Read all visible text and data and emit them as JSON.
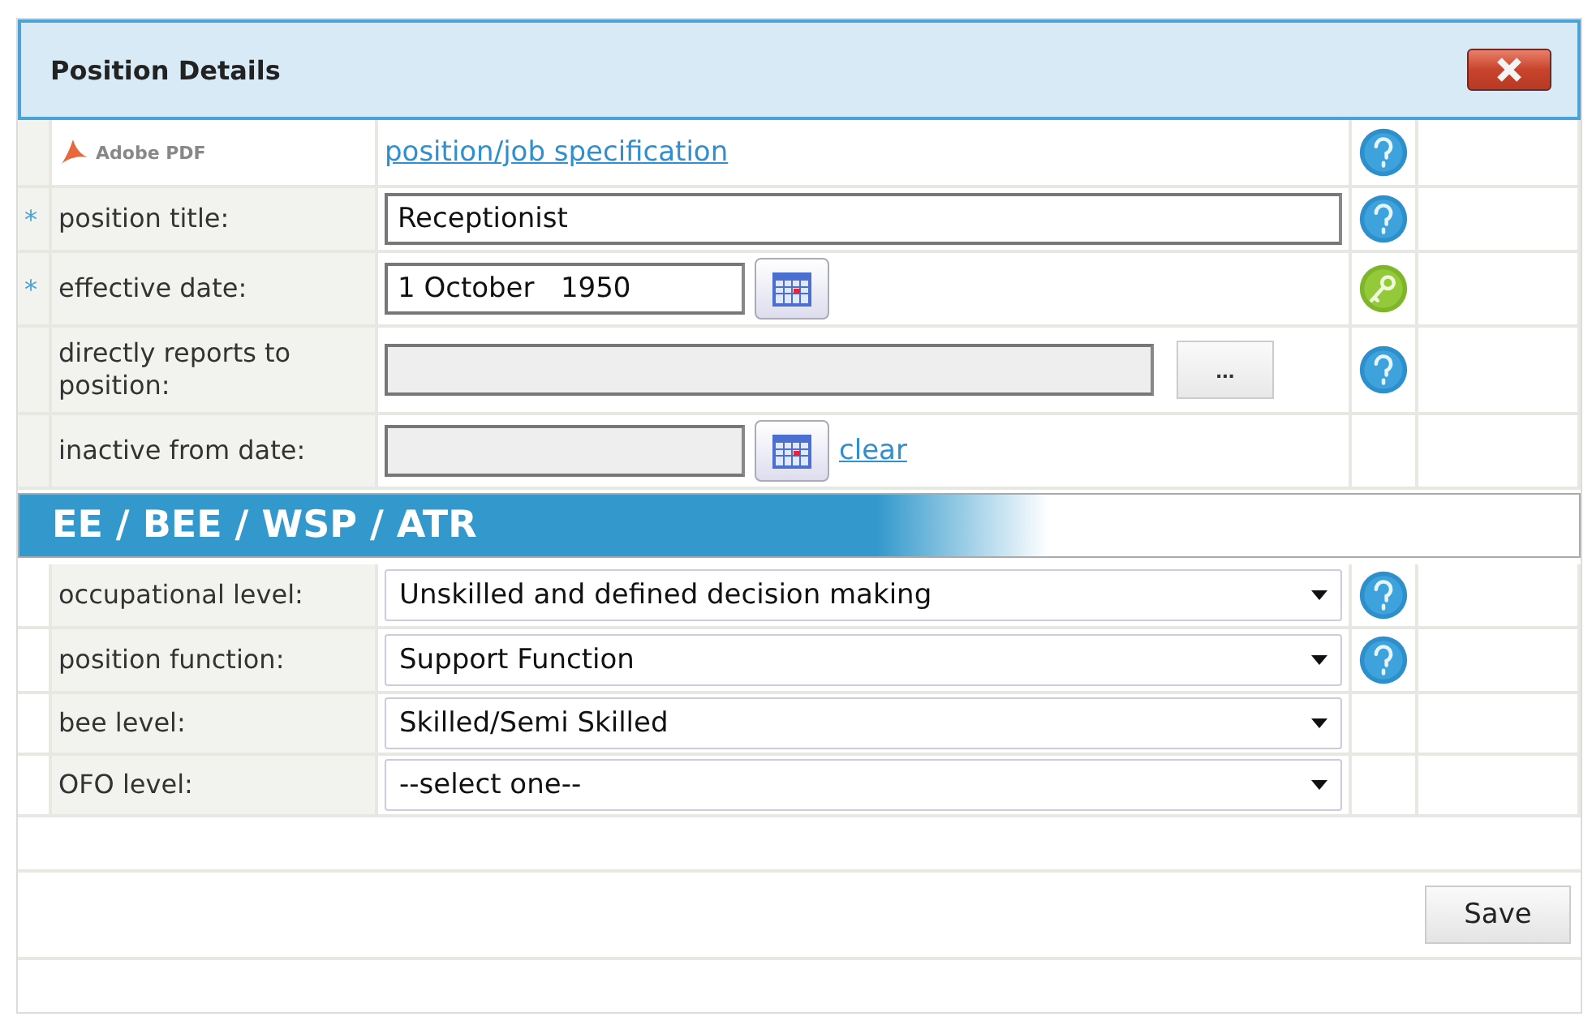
{
  "panel": {
    "title": "Position Details"
  },
  "document": {
    "badge": "Adobe PDF",
    "link": "position/job specification"
  },
  "fields": [
    {
      "kind": "text",
      "marker": "*",
      "label": "position title:",
      "disabled": false,
      "value": "Receptionist"
    },
    {
      "kind": "date",
      "marker": "*",
      "label": "effective date:",
      "disabled": false,
      "value": "1 October   1950"
    },
    {
      "kind": "lookup",
      "label": "directly reports to position:",
      "disabled": true,
      "button": "..."
    },
    {
      "kind": "date",
      "label": "inactive from date:",
      "disabled": true,
      "link": "clear"
    }
  ],
  "section": {
    "title": "EE / BEE / WSP / ATR"
  },
  "selects": [
    {
      "label": "occupational level:",
      "value": "Unskilled and defined decision making"
    },
    {
      "label": "position function:",
      "value": "Support Function"
    },
    {
      "label": "bee level:",
      "value": "Skilled/Semi Skilled"
    },
    {
      "label": "OFO level:",
      "value": "--select one--"
    }
  ],
  "save": "Save"
}
